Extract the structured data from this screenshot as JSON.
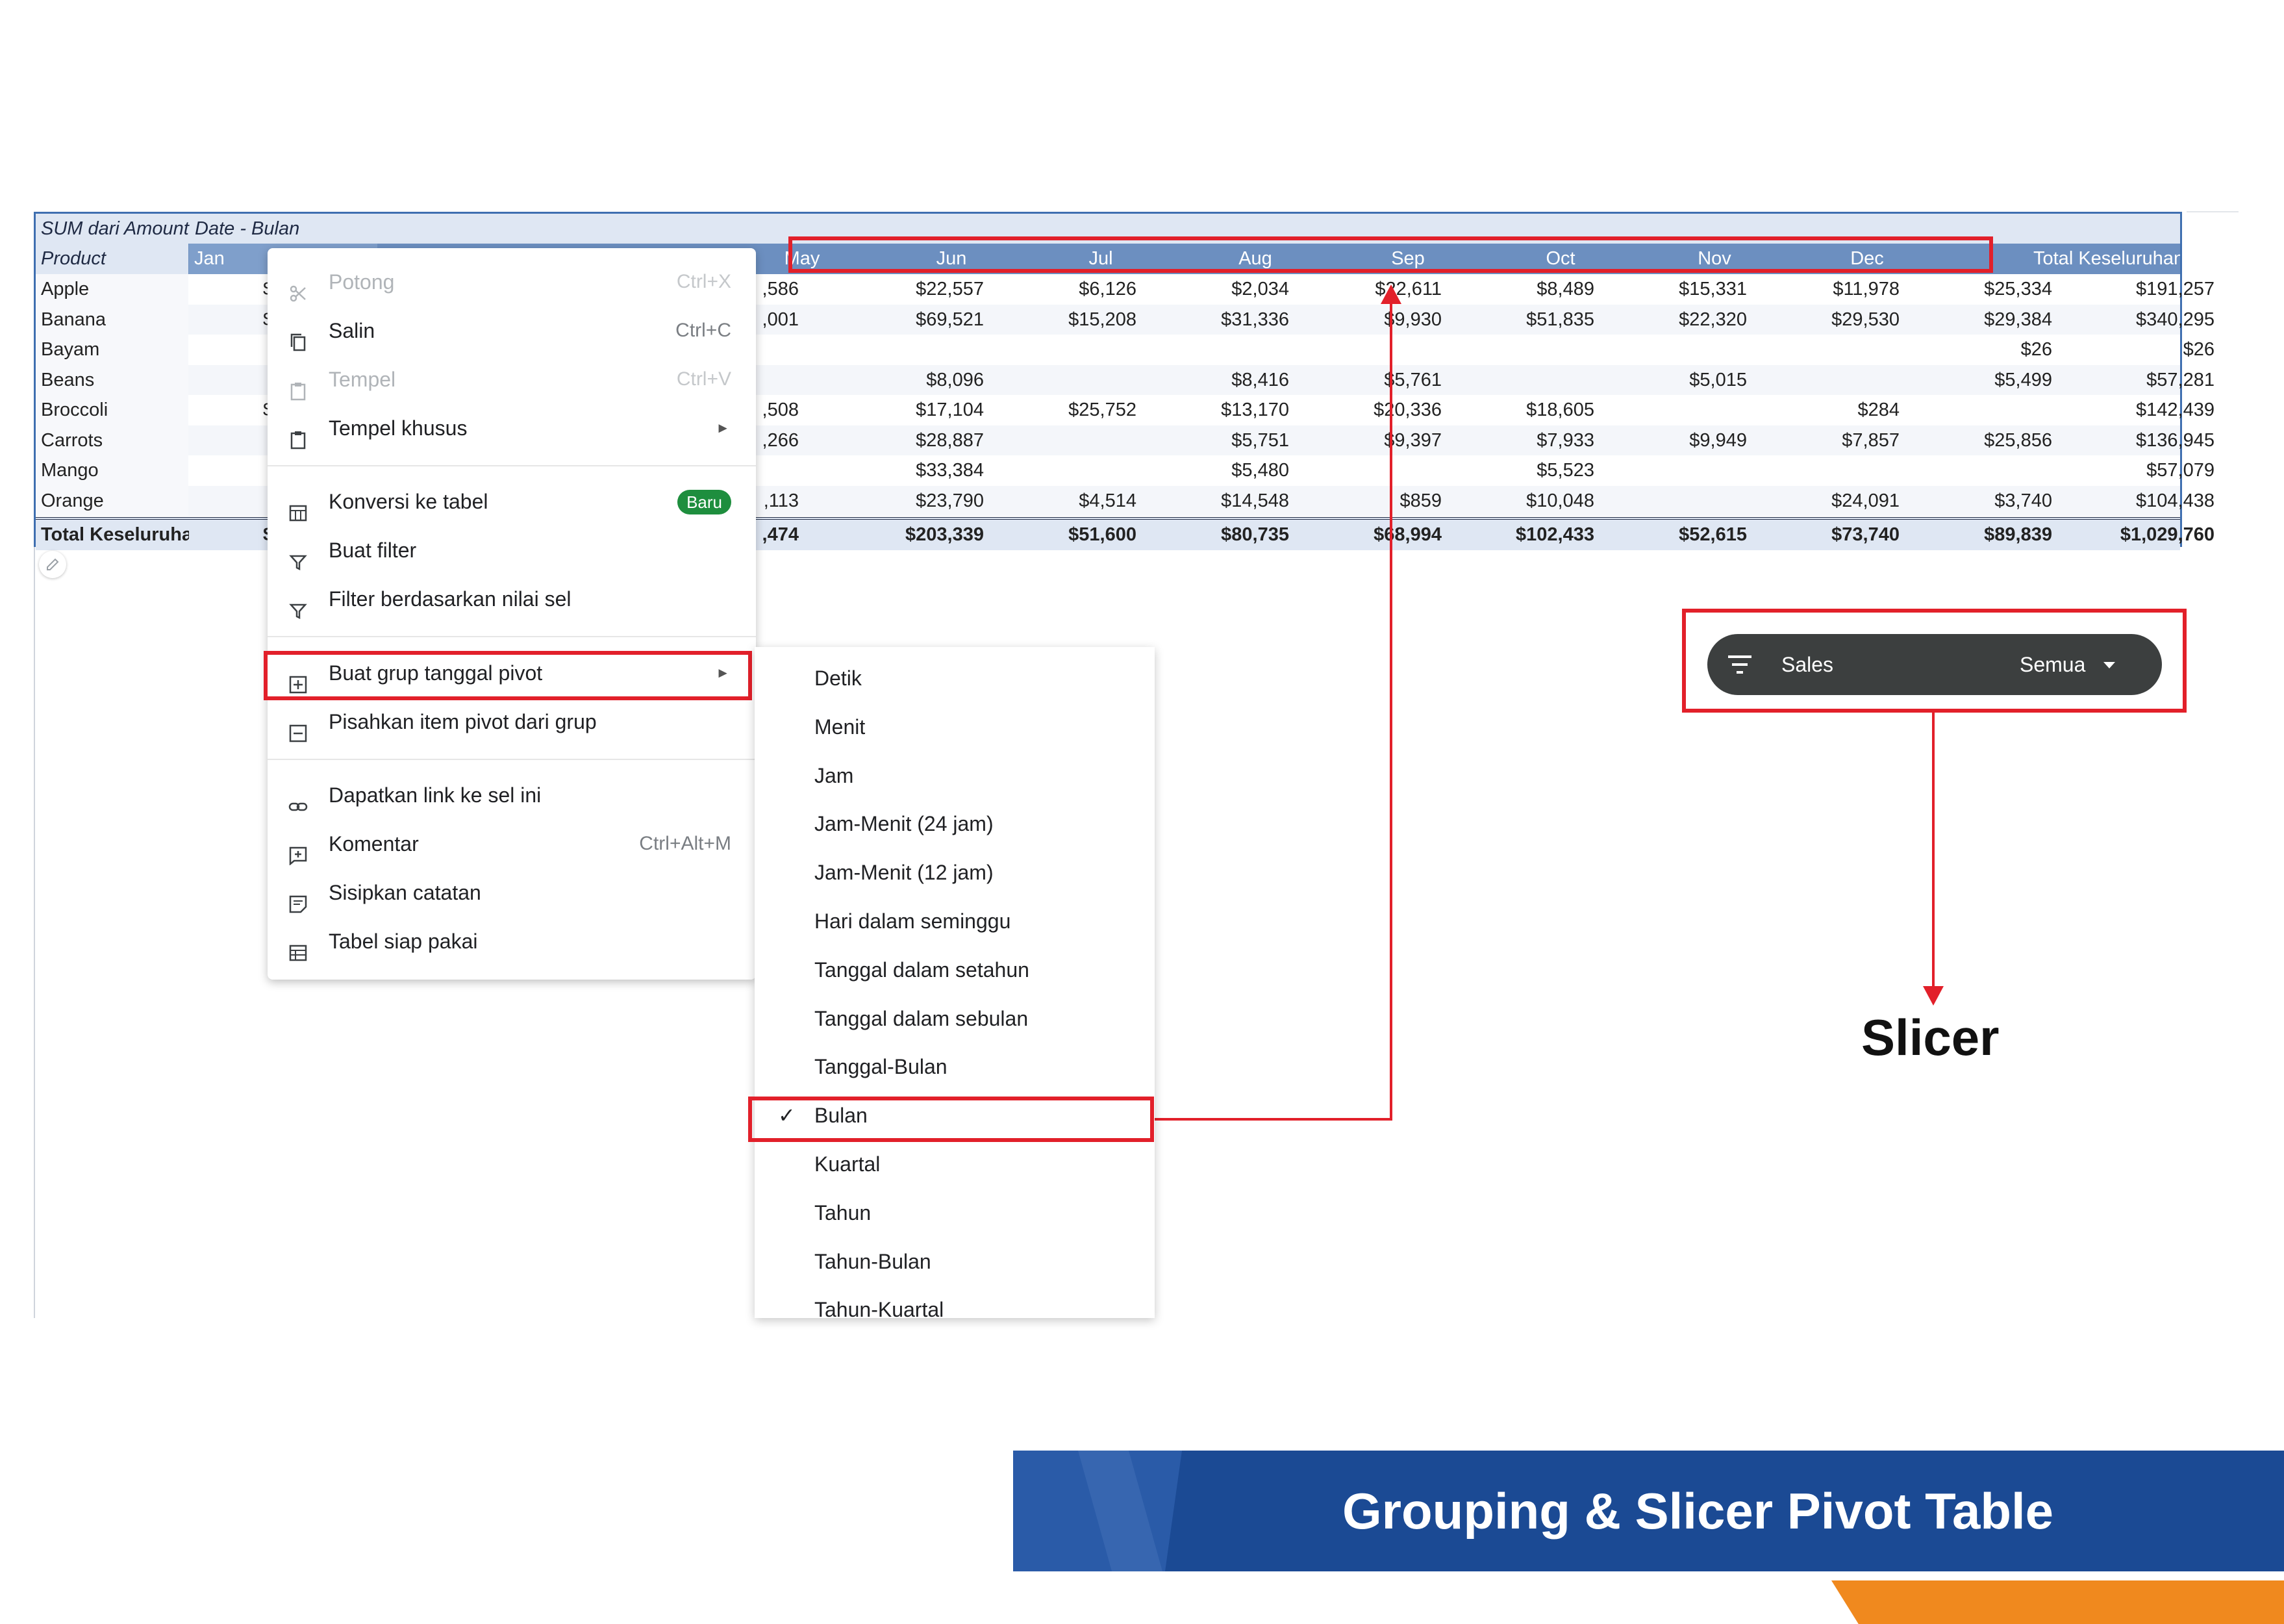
{
  "pivot": {
    "header_row1": {
      "sum_label": "SUM dari Amount",
      "date_label": "Date - Bulan"
    },
    "header_row2": {
      "product_label": "Product",
      "months": [
        "Jan",
        "May",
        "Jun",
        "Jul",
        "Aug",
        "Sep",
        "Oct",
        "Nov",
        "Dec"
      ],
      "total_label": "Total Keseluruhan"
    },
    "rows": [
      {
        "product": "Apple",
        "partial": "$",
        "apr": ",586",
        "values": [
          "$22,557",
          "$6,126",
          "$2,034",
          "$22,611",
          "$8,489",
          "$15,331",
          "$11,978",
          "$25,334"
        ],
        "total": "$191,257"
      },
      {
        "product": "Banana",
        "partial": "$",
        "apr": ",001",
        "values": [
          "$69,521",
          "$15,208",
          "$31,336",
          "$9,930",
          "$51,835",
          "$22,320",
          "$29,530",
          "$29,384"
        ],
        "total": "$340,295"
      },
      {
        "product": "Bayam",
        "partial": "",
        "apr": "",
        "values": [
          "",
          "",
          "",
          "",
          "",
          "",
          "",
          "$26"
        ],
        "total": "$26"
      },
      {
        "product": "Beans",
        "partial": "",
        "apr": "",
        "values": [
          "$8,096",
          "",
          "$8,416",
          "$5,761",
          "",
          "$5,015",
          "",
          "$5,499"
        ],
        "total": "$57,281"
      },
      {
        "product": "Broccoli",
        "partial": "$",
        "apr": ",508",
        "values": [
          "$17,104",
          "$25,752",
          "$13,170",
          "$20,336",
          "$18,605",
          "",
          "$284",
          ""
        ],
        "total": "$142,439"
      },
      {
        "product": "Carrots",
        "partial": "",
        "apr": ",266",
        "values": [
          "$28,887",
          "",
          "$5,751",
          "$9,397",
          "$7,933",
          "$9,949",
          "$7,857",
          "$25,856"
        ],
        "total": "$136,945"
      },
      {
        "product": "Mango",
        "partial": "",
        "apr": "",
        "values": [
          "$33,384",
          "",
          "$5,480",
          "",
          "$5,523",
          "",
          "",
          ""
        ],
        "total": "$57,079"
      },
      {
        "product": "Orange",
        "partial": "",
        "apr": ",113",
        "values": [
          "$23,790",
          "$4,514",
          "$14,548",
          "$859",
          "$10,048",
          "",
          "$24,091",
          "$3,740"
        ],
        "total": "$104,438"
      }
    ],
    "total_row": {
      "label": "Total Keseluruhan",
      "partial": "$",
      "apr": ",474",
      "values": [
        "$203,339",
        "$51,600",
        "$80,735",
        "$68,994",
        "$102,433",
        "$52,615",
        "$73,740",
        "$89,839"
      ],
      "total": "$1,029,760"
    }
  },
  "context_menu": {
    "cut": {
      "label": "Potong",
      "shortcut": "Ctrl+X"
    },
    "copy": {
      "label": "Salin",
      "shortcut": "Ctrl+C"
    },
    "paste": {
      "label": "Tempel",
      "shortcut": "Ctrl+V"
    },
    "paste_special": {
      "label": "Tempel khusus"
    },
    "convert_table": {
      "label": "Konversi ke tabel",
      "badge": "Baru"
    },
    "create_filter": {
      "label": "Buat filter"
    },
    "filter_by_value": {
      "label": "Filter berdasarkan nilai sel"
    },
    "create_date_group": {
      "label": "Buat grup tanggal pivot"
    },
    "ungroup": {
      "label": "Pisahkan item pivot dari grup"
    },
    "get_link": {
      "label": "Dapatkan link ke sel ini"
    },
    "comment": {
      "label": "Komentar",
      "shortcut": "Ctrl+Alt+M"
    },
    "insert_note": {
      "label": "Sisipkan catatan"
    },
    "smart_table": {
      "label": "Tabel siap pakai"
    }
  },
  "submenu": {
    "items": [
      "Detik",
      "Menit",
      "Jam",
      "Jam-Menit (24 jam)",
      "Jam-Menit (12 jam)",
      "Hari dalam seminggu",
      "Tanggal dalam setahun",
      "Tanggal dalam sebulan",
      "Tanggal-Bulan",
      "Bulan",
      "Kuartal",
      "Tahun",
      "Tahun-Bulan",
      "Tahun-Kuartal"
    ],
    "checked": "Bulan"
  },
  "slicer": {
    "title": "Sales",
    "value": "Semua",
    "caption": "Slicer"
  },
  "banner": {
    "title": "Grouping & Slicer Pivot Table"
  },
  "colors": {
    "accent_red": "#e2202a",
    "pivot_header": "#6c8fc0",
    "banner_blue": "#1b4a94",
    "banner_orange": "#f0891e",
    "slicer_dark": "#3c3f3f",
    "badge_green": "#1e8e3e"
  }
}
